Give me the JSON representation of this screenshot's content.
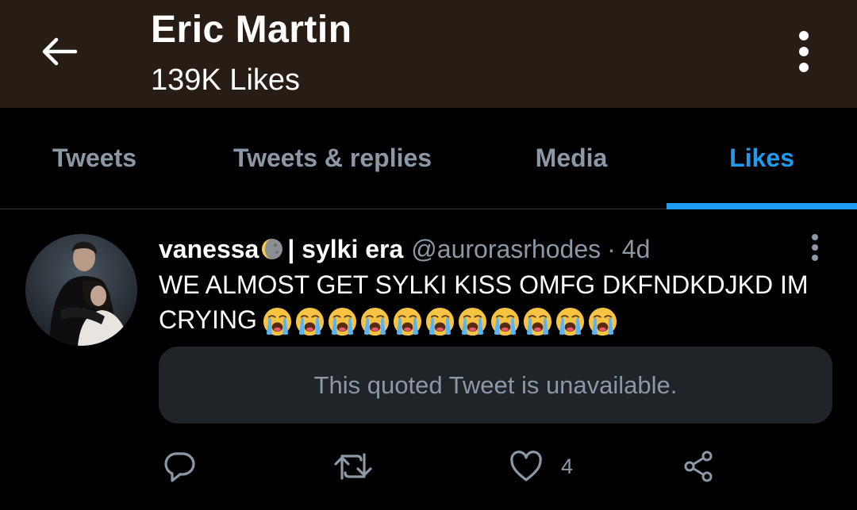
{
  "header": {
    "title": "Eric Martin",
    "subtitle": "139K Likes"
  },
  "tabs": [
    {
      "label": "Tweets",
      "active": false
    },
    {
      "label": "Tweets & replies",
      "active": false
    },
    {
      "label": "Media",
      "active": false
    },
    {
      "label": "Likes",
      "active": true
    }
  ],
  "tweet": {
    "display_name": "vanessa",
    "name_suffix": "| sylki era",
    "handle": "@aurorasrhodes",
    "separator": "·",
    "time": "4d",
    "text": "WE ALMOST GET SYLKI KISS OMFG DKFNDKDJKD IM CRYING",
    "emoji_count": 11,
    "quote_notice": "This quoted Tweet is unavailable.",
    "actions": {
      "reply_icon": "reply-icon",
      "retweet_icon": "retweet-icon",
      "like_icon": "heart-icon",
      "like_count": "4",
      "share_icon": "share-icon"
    }
  },
  "colors": {
    "header_bg": "#271d14",
    "accent": "#1d9bf0",
    "secondary_text": "#8b98a5",
    "quote_bg": "#202327"
  }
}
